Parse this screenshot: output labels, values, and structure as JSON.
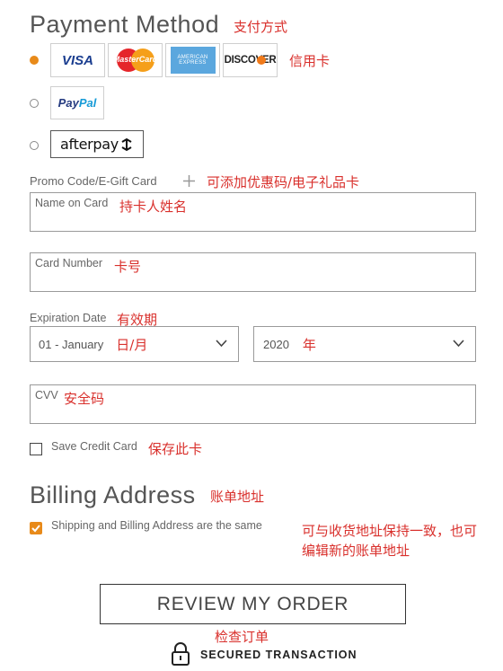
{
  "payment": {
    "title": "Payment Method",
    "title_note": "支付方式",
    "cards_note": "信用卡",
    "logos": {
      "visa": "VISA",
      "mastercard": "MasterCard",
      "amex_top": "AMERICAN",
      "amex_bottom": "EXPRESS",
      "discover": "DISCOVER",
      "paypal_pay": "Pay",
      "paypal_pal": "Pal",
      "afterpay": "afterpay"
    }
  },
  "promo": {
    "label": "Promo Code/E-Gift Card",
    "note": "可添加优惠码/电子礼品卡"
  },
  "name_on_card": {
    "label": "Name on Card",
    "note": "持卡人姓名"
  },
  "card_number": {
    "label": "Card Number",
    "note": "卡号"
  },
  "expiration": {
    "label": "Expiration Date",
    "note": "有效期",
    "month_value": "01 - January",
    "month_note": "日/月",
    "year_value": "2020",
    "year_note": "年"
  },
  "cvv": {
    "label": "CVV",
    "note": "安全码"
  },
  "save_card": {
    "label": "Save Credit Card",
    "note": "保存此卡",
    "checked": false
  },
  "billing": {
    "title": "Billing Address",
    "title_note": "账单地址",
    "same_label": "Shipping and Billing Address are the same",
    "same_checked": true,
    "same_note_line1": "可与收货地址保持一致，也可",
    "same_note_line2": "编辑新的账单地址"
  },
  "review_button": {
    "label": "REVIEW MY ORDER",
    "note": "检查订单"
  },
  "secured": {
    "label": "SECURED TRANSACTION"
  },
  "colors": {
    "accent": "#e88a1a",
    "annotation": "#d9302c"
  }
}
